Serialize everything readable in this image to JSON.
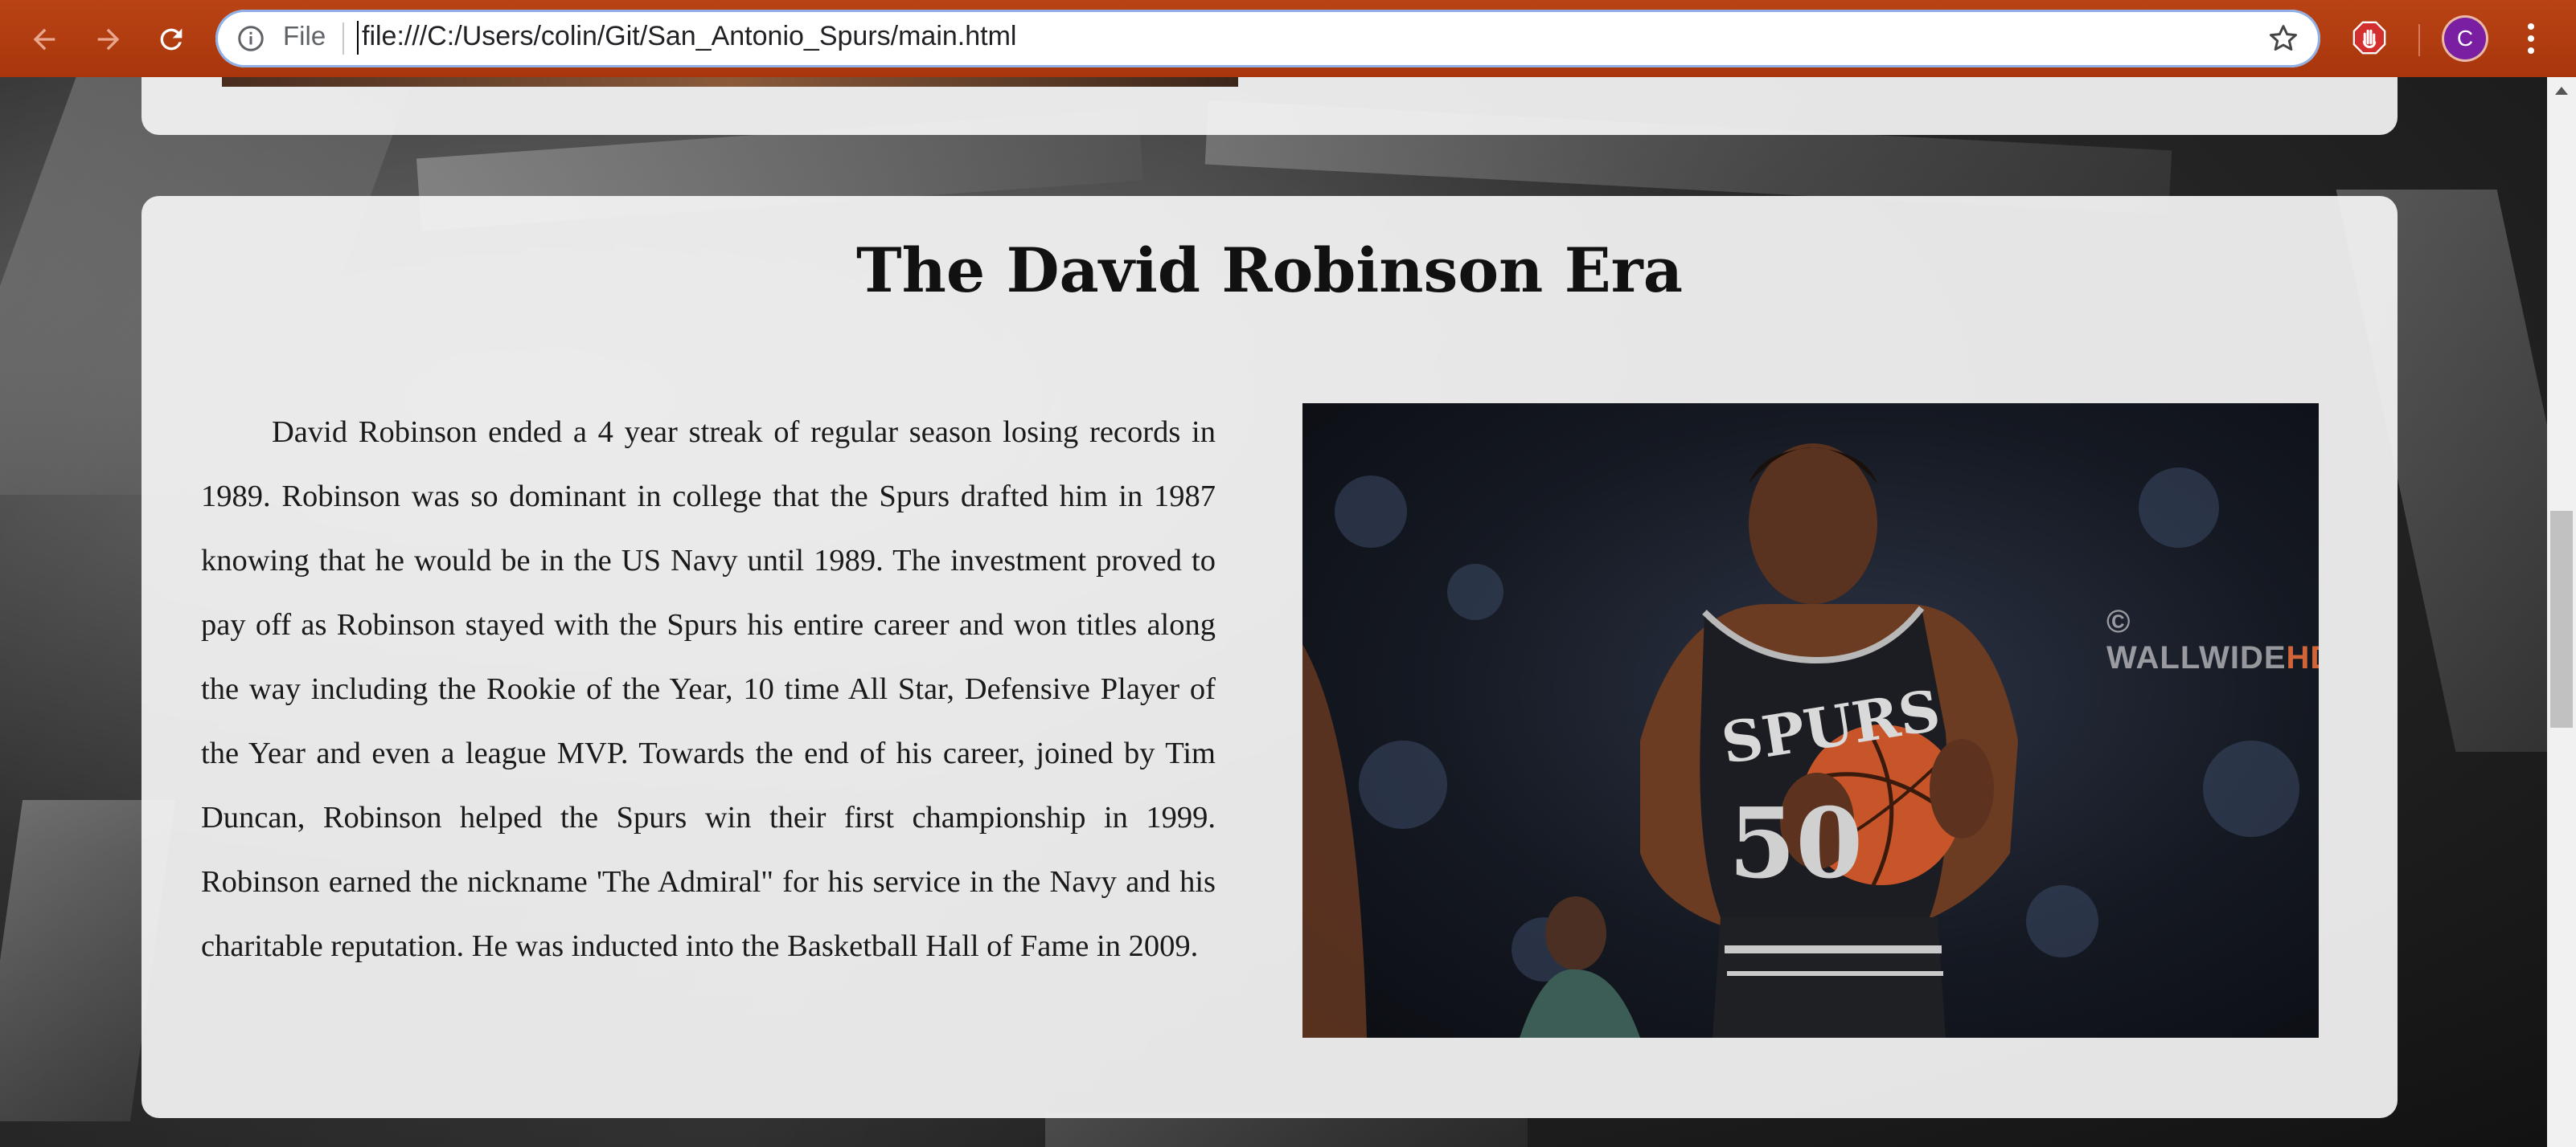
{
  "browser": {
    "omnibox": {
      "security_label": "File",
      "url": "file:///C:/Users/colin/Git/San_Antonio_Spurs/main.html"
    },
    "profile_initial": "C",
    "icons": {
      "back": "arrow-left-icon",
      "forward": "arrow-right-icon",
      "reload": "reload-icon",
      "info": "info-icon",
      "bookmark": "star-icon",
      "extension": "hand-stop-icon",
      "menu": "kebab-menu-icon"
    },
    "colors": {
      "toolbar": "#b13a0f",
      "avatar": "#7b1fa2",
      "extension": "#d32f2f"
    }
  },
  "section": {
    "title": "The David Robinson Era",
    "body": "David Robinson ended a 4 year streak of regular season losing records in 1989. Robinson was so dominant in college that the Spurs drafted him in 1987 knowing that he would be in the US Navy until 1989. The investment proved to pay off as Robinson stayed with the Spurs his entire career and won titles along the way including the Rookie of the Year, 10 time All Star, Defensive Player of the Year and even a league MVP. Towards the end of his career, joined by Tim Duncan, Robinson helped the Spurs win their first championship in 1999. Robinson earned the nickname 'The Admiral\" for his service in the Navy and his charitable reputation. He was inducted into the Basketball Hall of Fame in 2009.",
    "photo": {
      "jersey_text": "SPURS",
      "jersey_number": "50",
      "watermark_a": "© WALLWIDE",
      "watermark_b": "HD.COM"
    }
  }
}
